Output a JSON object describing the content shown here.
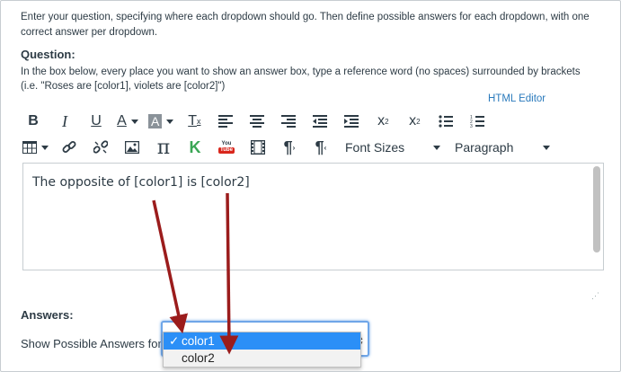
{
  "intro_text": "Enter your question, specifying where each dropdown should go. Then define possible answers for each dropdown, with one correct answer per dropdown.",
  "question": {
    "title": "Question:",
    "hint_line1": "In the box below, every place you want to show an answer box, type a reference word (no spaces) surrounded by brackets",
    "hint_line2": "(i.e. \"Roses are [color1], violets are [color2]\")",
    "html_editor_link": "HTML Editor"
  },
  "toolbar": {
    "row1_icons": [
      "bold-icon",
      "italic-icon",
      "underline-icon",
      "text-color-icon",
      "background-color-icon",
      "clear-formatting-icon",
      "align-left-icon",
      "align-center-icon",
      "align-right-icon",
      "outdent-icon",
      "indent-icon",
      "superscript-icon",
      "subscript-icon",
      "bullet-list-icon",
      "numbered-list-icon"
    ],
    "row2_icons": [
      "table-icon",
      "link-icon",
      "unlink-icon",
      "image-icon",
      "math-equation-icon",
      "kaltura-icon",
      "youtube-icon",
      "media-icon",
      "ltr-paragraph-icon",
      "rtl-paragraph-icon"
    ],
    "font_sizes_label": "Font Sizes",
    "paragraph_label": "Paragraph",
    "youtube_text": "You Tube"
  },
  "editor": {
    "content": "The opposite of [color1] is [color2]"
  },
  "answers": {
    "title": "Answers:",
    "show_label": "Show Possible Answers for",
    "dropdown_options": [
      "color1",
      "color2"
    ],
    "selected_option": "color1",
    "check_mark": "✓"
  },
  "colors": {
    "accent_link": "#2a7abc",
    "selected_option_bg": "#2b8ff7",
    "annotation_arrow": "#9b1c1c",
    "focus_ring": "#6fa6e8"
  }
}
